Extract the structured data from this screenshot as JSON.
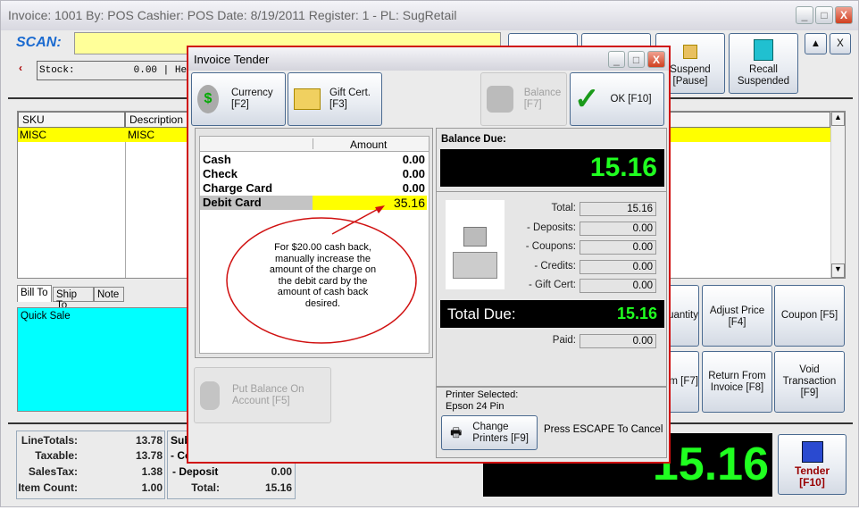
{
  "window": {
    "title": "Invoice: 1001  By: POS  Cashier: POS   Date:  8/19/2011  Register: 1 - PL: SugRetail"
  },
  "scan": {
    "label": "SCAN:",
    "value": ""
  },
  "stock": {
    "label": "Stock:",
    "value": "0.00",
    "rest": "| He"
  },
  "toolbar": {
    "suspend": [
      "Suspend",
      "[Pause]"
    ],
    "recall": [
      "Recall",
      "Suspended"
    ],
    "up": "▲",
    "close": "X"
  },
  "grid": {
    "columns": [
      "SKU",
      "Description"
    ],
    "rows": [
      {
        "sku": "MISC",
        "description": "MISC"
      }
    ]
  },
  "tabs": [
    "Bill To",
    "Ship To",
    "Note"
  ],
  "bill_to": "Quick Sale",
  "actions": {
    "quantity": "uantity",
    "adjust_price": "Adjust Price [F4]",
    "coupon": "Coupon [F5]",
    "item": "m [F7]",
    "return": [
      "Return From",
      "Invoice [F8]"
    ],
    "void": [
      "Void",
      "Transaction [F9]"
    ]
  },
  "totals": {
    "line_totals": {
      "label": "LineTotals:",
      "value": "13.78"
    },
    "taxable": {
      "label": "Taxable:",
      "value": "13.78"
    },
    "sales_tax": {
      "label": "SalesTax:",
      "value": "1.38"
    },
    "item_count": {
      "label": "Item Count:",
      "value": "1.00"
    },
    "sub": "Sub",
    "c": "- Co",
    "deposit": {
      "label": "- Deposit",
      "value": "0.00"
    },
    "total": {
      "label": "Total:",
      "value": "15.16"
    }
  },
  "big_total": "15.16",
  "tender": {
    "label": "Tender",
    "key": "[F10]"
  },
  "dialog": {
    "title": "Invoice Tender",
    "currency": [
      "Currency",
      "[F2]"
    ],
    "gift_cert": [
      "Gift Cert.",
      "[F3]"
    ],
    "balance": [
      "Balance",
      "[F7]"
    ],
    "ok": "OK [F10]",
    "amount_header": "Amount",
    "tenders": [
      {
        "name": "Cash",
        "amount": "0.00"
      },
      {
        "name": "Check",
        "amount": "0.00"
      },
      {
        "name": "Charge Card",
        "amount": "0.00"
      },
      {
        "name": "Debit Card",
        "amount": "35.16"
      }
    ],
    "callout": "For $20.00 cash back, manually increase the amount of the charge on the debit card by the amount of cash back desired.",
    "put_balance": [
      "Put Balance On",
      "Account [F5]"
    ],
    "balance_due_label": "Balance Due:",
    "balance_due": "15.16",
    "summary": [
      {
        "label": "Total:",
        "value": "15.16"
      },
      {
        "label": "- Deposits:",
        "value": "0.00"
      },
      {
        "label": "- Coupons:",
        "value": "0.00"
      },
      {
        "label": "- Credits:",
        "value": "0.00"
      },
      {
        "label": "- Gift Cert:",
        "value": "0.00"
      }
    ],
    "total_due_label": "Total Due:",
    "total_due": "15.16",
    "paid": {
      "label": "Paid:",
      "value": "0.00"
    },
    "printer_label": "Printer Selected:",
    "printer": "Epson 24 Pin",
    "change_printers": [
      "Change",
      "Printers [F9]"
    ],
    "escape": "Press ESCAPE To Cancel"
  },
  "colors": {
    "accent_red": "#d01010",
    "scan_blue": "#1a6ad0",
    "yellow": "#ffff00",
    "cyan": "#00ffff",
    "digit_green": "#20ff20"
  }
}
